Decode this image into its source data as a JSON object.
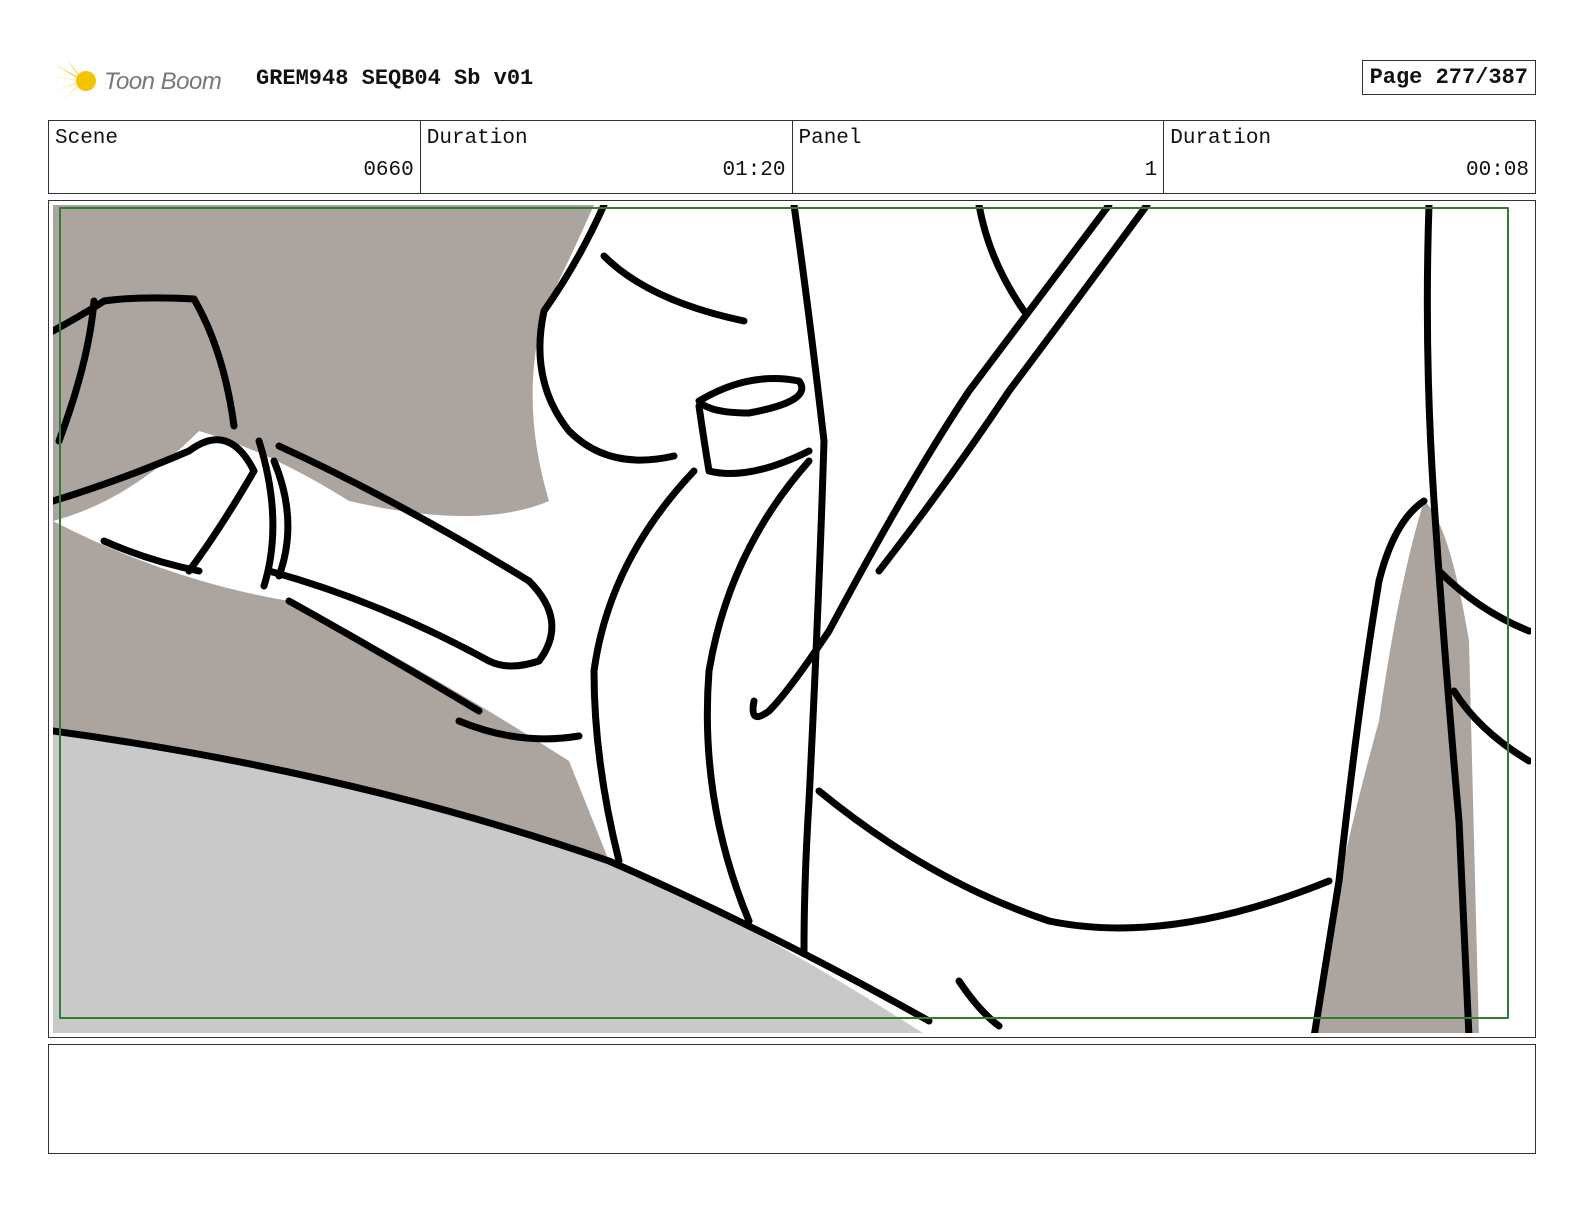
{
  "header": {
    "logo_text": "Toon Boom",
    "title": "GREM948 SEQB04 Sb v01",
    "page": "Page 277/387"
  },
  "info": {
    "scene_label": "Scene",
    "scene_value": "0660",
    "scene_duration_label": "Duration",
    "scene_duration_value": "01:20",
    "panel_label": "Panel",
    "panel_value": "1",
    "panel_duration_label": "Duration",
    "panel_duration_value": "00:08"
  },
  "colors": {
    "logo_accent": "#f5c400",
    "safe_frame": "#2e7d32",
    "shadow_tone": "#aca49f",
    "ground_tone": "#c9c9c9"
  },
  "notes": ""
}
